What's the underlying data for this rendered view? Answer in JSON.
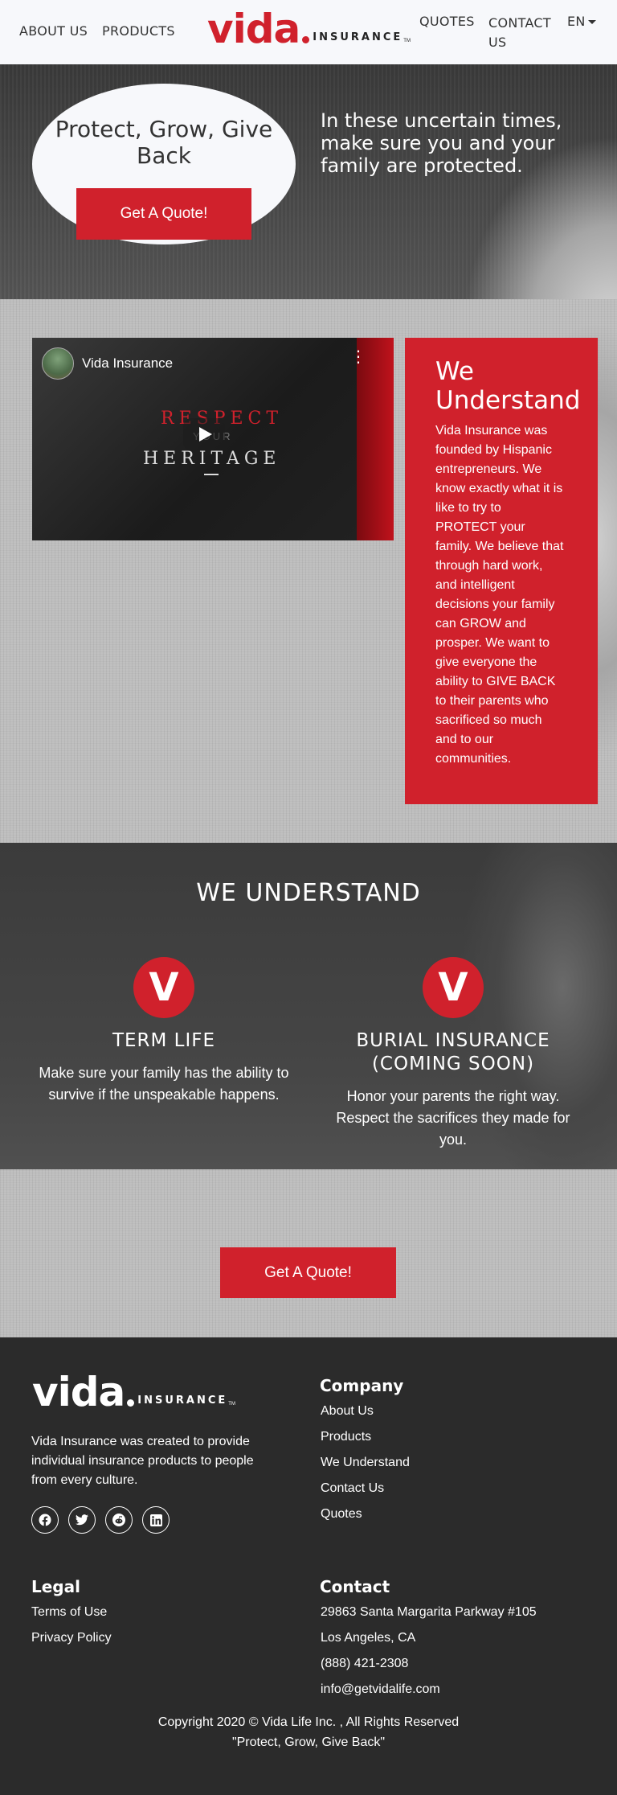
{
  "nav": {
    "about": "ABOUT US",
    "products": "PRODUCTS",
    "quotes": "QUOTES",
    "contact": "CONTACT US",
    "lang": "EN",
    "logo_main": "vida",
    "logo_sub": "INSURANCE",
    "logo_tm": "TM"
  },
  "hero": {
    "title": "Protect, Grow, Give Back",
    "button": "Get A Quote!",
    "tagline": "In these uncertain times, make sure you and your family are protected."
  },
  "video": {
    "channel": "Vida Insurance",
    "line1": "RESPECT",
    "line2": "YOUR",
    "line3": "HERITAGE"
  },
  "understand_card": {
    "title": "We Understand",
    "text": "Vida Insurance was founded by Hispanic entrepreneurs. We know exactly what it is like to try to PROTECT your family. We believe that through hard work, and intelligent decisions your family can GROW and prosper. We want to give everyone the ability to GIVE BACK to their parents who sacrificed so much and to our communities."
  },
  "services": {
    "title": "WE UNDERSTAND",
    "items": [
      {
        "icon": "V",
        "title": "TERM LIFE",
        "text": "Make sure your family has the ability to survive if the unspeakable happens."
      },
      {
        "icon": "V",
        "title": "BURIAL INSURANCE (COMING SOON)",
        "text": "Honor your parents the right way. Respect the sacrifices they made for you."
      }
    ]
  },
  "cta": {
    "button": "Get A Quote!"
  },
  "footer": {
    "logo_main": "vida",
    "logo_sub": "INSURANCE",
    "logo_tm": "TM",
    "about": "Vida Insurance was created to provide individual insurance products to people from every culture.",
    "socials": [
      "facebook-icon",
      "twitter-icon",
      "reddit-icon",
      "linkedin-icon"
    ],
    "company": {
      "title": "Company",
      "links": [
        "About Us",
        "Products",
        "We Understand",
        "Contact Us",
        "Quotes"
      ]
    },
    "legal": {
      "title": "Legal",
      "links": [
        "Terms of Use",
        "Privacy Policy"
      ]
    },
    "contact": {
      "title": "Contact",
      "address1": "29863 Santa Margarita Parkway #105",
      "address2": "Los Angeles, CA",
      "phone": "(888) 421-2308",
      "email": "info@getvidalife.com"
    },
    "copyright": "Copyright 2020 © Vida Life Inc. , All Rights Reserved",
    "slogan": "\"Protect, Grow, Give Back\""
  },
  "colors": {
    "brand_red": "#d0212c",
    "nav_bg": "#f7f8fb",
    "footer_bg": "#2b2b2b"
  }
}
